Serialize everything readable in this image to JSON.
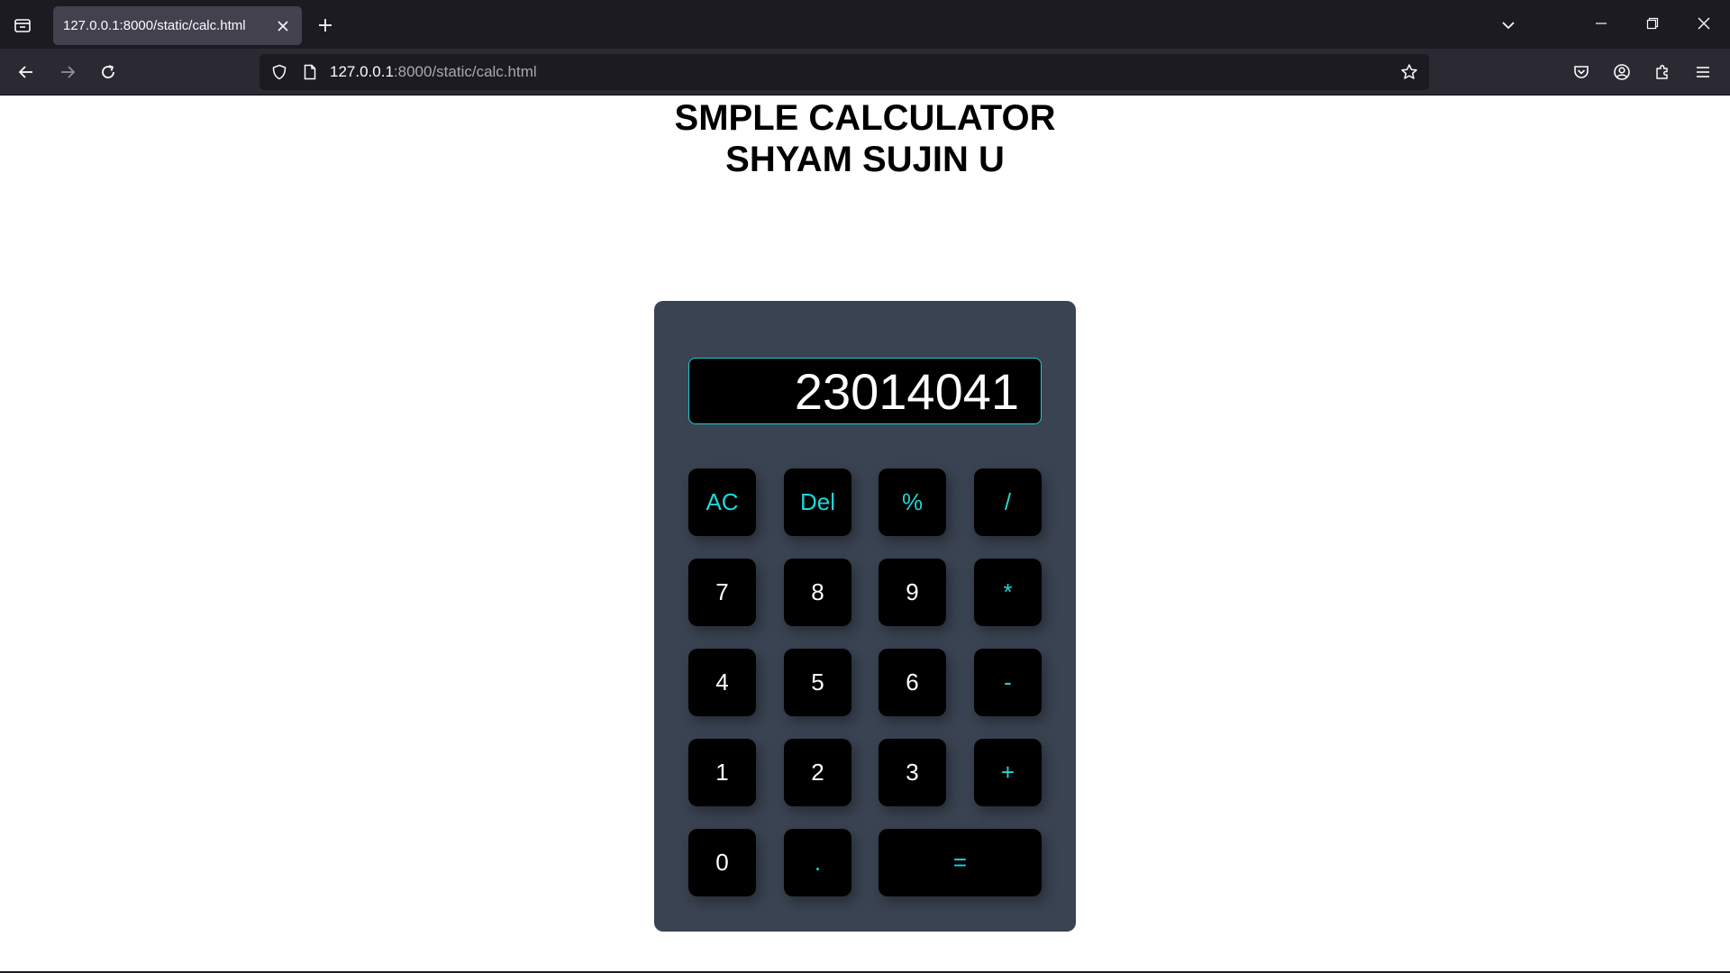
{
  "browser": {
    "tab": {
      "title": "127.0.0.1:8000/static/calc.html"
    },
    "url": {
      "host": "127.0.0.1",
      "rest": ":8000/static/calc.html"
    }
  },
  "page": {
    "heading_line1": "SMPLE CALCULATOR",
    "heading_line2": "SHYAM SUJIN U"
  },
  "calculator": {
    "display_value": "23014041",
    "keys": {
      "ac": "AC",
      "del": "Del",
      "percent": "%",
      "divide": "/",
      "seven": "7",
      "eight": "8",
      "nine": "9",
      "multiply": "*",
      "four": "4",
      "five": "5",
      "six": "6",
      "minus": "-",
      "one": "1",
      "two": "2",
      "three": "3",
      "plus": "+",
      "zero": "0",
      "dot": ".",
      "equals": "="
    }
  },
  "colors": {
    "calculator_body": "#3a4352",
    "key_background": "#000000",
    "operator_text": "#1fd6d6",
    "display_border": "#1ccfcf"
  }
}
